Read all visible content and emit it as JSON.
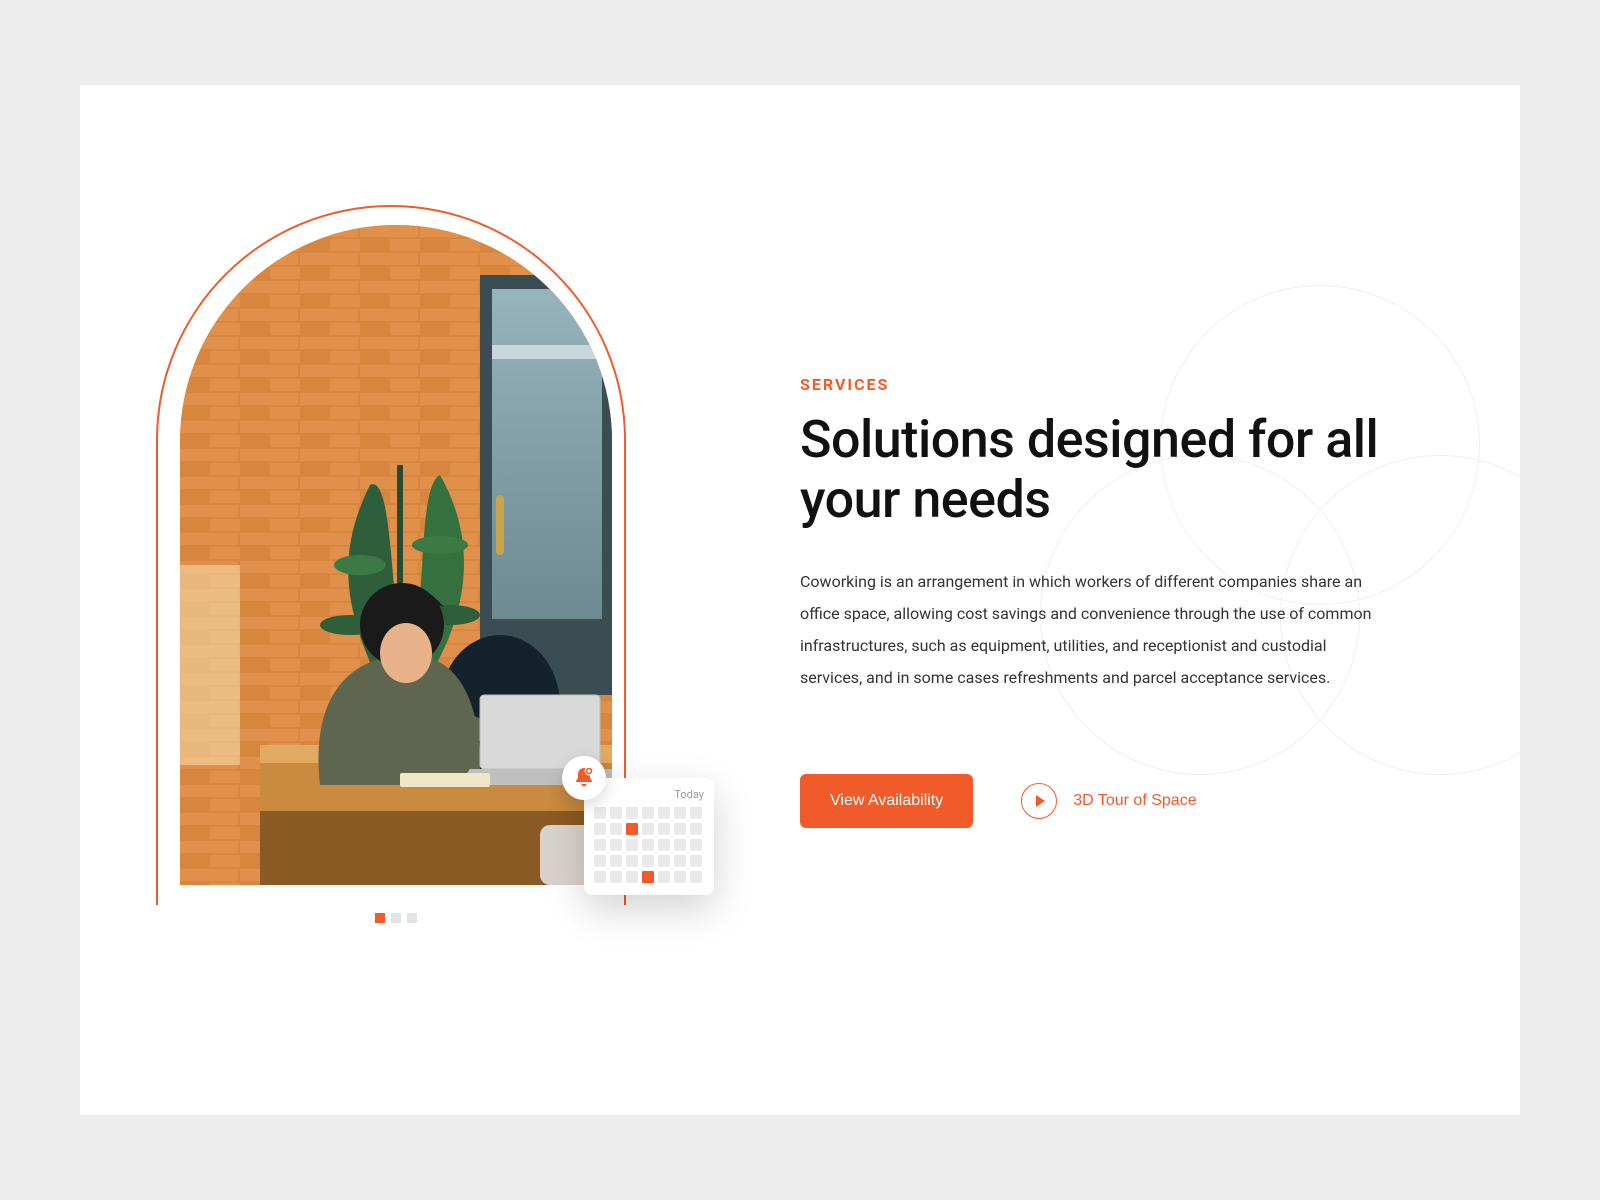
{
  "eyebrow": "SERVICES",
  "headline": "Solutions designed for all your needs",
  "body": "Coworking is an arrangement in which workers of different companies share an office space, allowing cost savings and convenience through the use of common infrastructures, such as equipment, utilities, and receptionist and custodial services, and in some cases refreshments and parcel acceptance services.",
  "cta_primary": "View Availability",
  "cta_secondary": "3D Tour of Space",
  "calendar": {
    "label": "Today",
    "rows": 5,
    "cols": 7,
    "marked": [
      9,
      31
    ]
  },
  "carousel": {
    "count": 3,
    "active": 0
  },
  "colors": {
    "accent": "#f15a29"
  }
}
